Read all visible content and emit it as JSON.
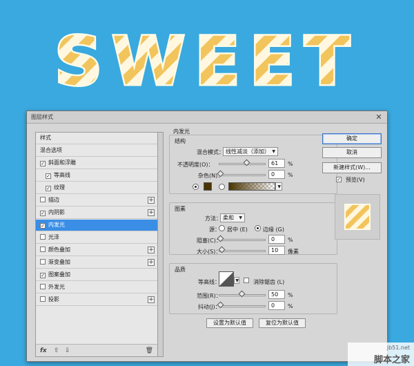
{
  "banner": {
    "text": "SWEET"
  },
  "dialog": {
    "title": "图层样式",
    "close_glyph": "✕",
    "style_list": [
      {
        "label": "样式",
        "checkbox": false,
        "checked": false,
        "plus": false,
        "sub": false,
        "active": false
      },
      {
        "label": "混合选项",
        "checkbox": false,
        "checked": false,
        "plus": false,
        "sub": false,
        "active": false
      },
      {
        "label": "斜面和浮雕",
        "checkbox": true,
        "checked": true,
        "plus": false,
        "sub": false,
        "active": false
      },
      {
        "label": "等高线",
        "checkbox": true,
        "checked": true,
        "plus": false,
        "sub": true,
        "active": false
      },
      {
        "label": "纹理",
        "checkbox": true,
        "checked": true,
        "plus": false,
        "sub": true,
        "active": false
      },
      {
        "label": "描边",
        "checkbox": true,
        "checked": false,
        "plus": true,
        "sub": false,
        "active": false
      },
      {
        "label": "内阴影",
        "checkbox": true,
        "checked": true,
        "plus": true,
        "sub": false,
        "active": false
      },
      {
        "label": "内发光",
        "checkbox": true,
        "checked": true,
        "plus": false,
        "sub": false,
        "active": true
      },
      {
        "label": "光泽",
        "checkbox": true,
        "checked": false,
        "plus": false,
        "sub": false,
        "active": false
      },
      {
        "label": "颜色叠加",
        "checkbox": true,
        "checked": false,
        "plus": true,
        "sub": false,
        "active": false
      },
      {
        "label": "渐变叠加",
        "checkbox": true,
        "checked": false,
        "plus": true,
        "sub": false,
        "active": false
      },
      {
        "label": "图案叠加",
        "checkbox": true,
        "checked": true,
        "plus": false,
        "sub": false,
        "active": false
      },
      {
        "label": "外发光",
        "checkbox": true,
        "checked": false,
        "plus": false,
        "sub": false,
        "active": false
      },
      {
        "label": "投影",
        "checkbox": true,
        "checked": false,
        "plus": true,
        "sub": false,
        "active": false
      }
    ],
    "footer": {
      "fx": "fx",
      "up": "⇧",
      "down": "⇩",
      "trash": "🗑"
    },
    "panel": {
      "title": "内发光",
      "structure": {
        "title": "结构",
        "blend_mode_label": "混合模式：",
        "blend_mode_value": "线性减淡（添加）",
        "opacity_label": "不透明度(O)：",
        "opacity_value": "61",
        "opacity_level": 61,
        "noise_label": "杂色(N)：",
        "noise_value": "0",
        "noise_level": 0,
        "percent": "%",
        "glow_color": "#4a3400"
      },
      "elements": {
        "title": "图素",
        "technique_label": "方法：",
        "technique_value": "柔和",
        "source_label": "源：",
        "center_label": "居中 (E)",
        "edge_label": "边缘 (G)",
        "choke_label": "阻塞(C)：",
        "choke_value": "0",
        "choke_level": 0,
        "size_label": "大小(S)：",
        "size_value": "10",
        "size_level": 4,
        "size_unit": "像素"
      },
      "quality": {
        "title": "品质",
        "contour_label": "等高线：",
        "antialias_label": "消除锯齿 (L)",
        "range_label": "范围(R)：",
        "range_value": "50",
        "range_level": 50,
        "jitter_label": "抖动(J)：",
        "jitter_value": "0",
        "jitter_level": 0
      },
      "make_default": "设置为默认值",
      "reset_default": "复位为默认值"
    },
    "buttons": {
      "ok": "确定",
      "cancel": "取消",
      "new_style": "新建样式(W)...",
      "preview": "预览(V)"
    }
  },
  "watermark": {
    "site": "jb51.net",
    "name": "脚本之家"
  }
}
